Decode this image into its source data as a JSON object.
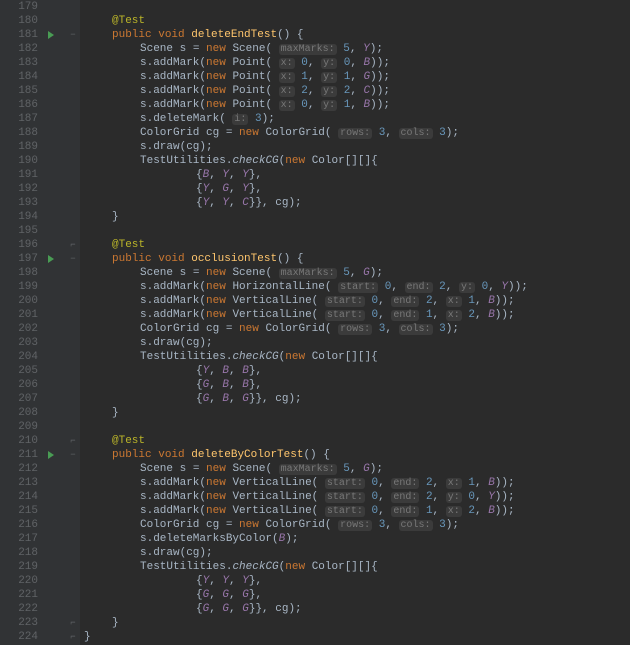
{
  "gutter": {
    "start": 179,
    "end": 224
  },
  "runMarkers": [
    181,
    197,
    211
  ],
  "foldMarkers": [
    {
      "line": 181,
      "glyph": "−"
    },
    {
      "line": 196,
      "glyph": "⌐"
    },
    {
      "line": 197,
      "glyph": "−"
    },
    {
      "line": 210,
      "glyph": "⌐"
    },
    {
      "line": 211,
      "glyph": "−"
    },
    {
      "line": 223,
      "glyph": "⌐"
    },
    {
      "line": 224,
      "glyph": "⌐"
    }
  ],
  "tokens": {
    "ann_test": "@Test",
    "kw_public": "public",
    "kw_void": "void",
    "kw_new": "new",
    "fn_deleteEndTest": "deleteEndTest",
    "fn_occlusionTest": "occlusionTest",
    "fn_deleteByColorTest": "deleteByColorTest",
    "cls_Scene": "Scene",
    "cls_Point": "Point",
    "cls_Color": "Color",
    "cls_ColorGrid": "ColorGrid",
    "cls_HorizontalLine": "HorizontalLine",
    "cls_VerticalLine": "VerticalLine",
    "cls_TestUtilities": "TestUtilities",
    "mtd_addMark": "addMark",
    "mtd_deleteMark": "deleteMark",
    "mtd_deleteMarksByColor": "deleteMarksByColor",
    "mtd_draw": "draw",
    "mtd_checkCG": "checkCG",
    "var_s": "s",
    "var_cg": "cg",
    "h_maxMarks": "maxMarks:",
    "h_x": "x:",
    "h_y": "y:",
    "h_i": "i:",
    "h_rows": "rows:",
    "h_cols": "cols:",
    "h_start": "start:",
    "h_end": "end:",
    "n0": "0",
    "n1": "1",
    "n2": "2",
    "n3": "3",
    "n5": "5",
    "c_Y": "Y",
    "c_B": "B",
    "c_G": "G",
    "c_C": "C",
    "p_lparen": "(",
    "p_rparen": ")",
    "p_lbrace": "{",
    "p_rbrace": "}",
    "p_sc": ";",
    "p_cm": ",",
    "p_eq": " = ",
    "p_dot": ".",
    "p_lbrk": "[",
    "p_rbrk": "]",
    "p_dbr": "[][]{"
  },
  "chart_data": {
    "type": "table",
    "title": "IDE code editor (IntelliJ-style) – Java unit tests",
    "tests": [
      {
        "name": "deleteEndTest",
        "lines": [
          180,
          196
        ],
        "scene": {
          "maxMarks": 5,
          "arg2": "Y"
        },
        "marks": [
          {
            "shape": "Point",
            "x": 0,
            "y": 0,
            "color": "B"
          },
          {
            "shape": "Point",
            "x": 1,
            "y": 1,
            "color": "G"
          },
          {
            "shape": "Point",
            "x": 2,
            "y": 2,
            "color": "C"
          },
          {
            "shape": "Point",
            "x": 0,
            "y": 1,
            "color": "B"
          }
        ],
        "ops": [
          {
            "call": "deleteMark",
            "i": 3
          }
        ],
        "grid": {
          "rows": 3,
          "cols": 3
        },
        "expected": [
          [
            "B",
            "Y",
            "Y"
          ],
          [
            "Y",
            "G",
            "Y"
          ],
          [
            "Y",
            "Y",
            "C"
          ]
        ]
      },
      {
        "name": "occlusionTest",
        "lines": [
          196,
          210
        ],
        "scene": {
          "maxMarks": 5,
          "arg2": "G"
        },
        "marks": [
          {
            "shape": "HorizontalLine",
            "start": 0,
            "end": 2,
            "y": 0,
            "color": "Y"
          },
          {
            "shape": "VerticalLine",
            "start": 0,
            "end": 2,
            "x": 1,
            "color": "B"
          },
          {
            "shape": "VerticalLine",
            "start": 0,
            "end": 1,
            "x": 2,
            "color": "B"
          }
        ],
        "grid": {
          "rows": 3,
          "cols": 3
        },
        "expected": [
          [
            "Y",
            "B",
            "B"
          ],
          [
            "G",
            "B",
            "B"
          ],
          [
            "G",
            "B",
            "G"
          ]
        ]
      },
      {
        "name": "deleteByColorTest",
        "lines": [
          210,
          224
        ],
        "scene": {
          "maxMarks": 5,
          "arg2": "G"
        },
        "marks": [
          {
            "shape": "VerticalLine",
            "start": 0,
            "end": 2,
            "x": 1,
            "color": "B"
          },
          {
            "shape": "VerticalLine",
            "start": 0,
            "end": 2,
            "y": 0,
            "color": "Y"
          },
          {
            "shape": "VerticalLine",
            "start": 0,
            "end": 1,
            "x": 2,
            "color": "B"
          }
        ],
        "ops": [
          {
            "call": "deleteMarksByColor",
            "arg": "B"
          }
        ],
        "grid": {
          "rows": 3,
          "cols": 3
        },
        "expected": [
          [
            "Y",
            "Y",
            "Y"
          ],
          [
            "G",
            "G",
            "G"
          ],
          [
            "G",
            "G",
            "G"
          ]
        ]
      }
    ]
  }
}
